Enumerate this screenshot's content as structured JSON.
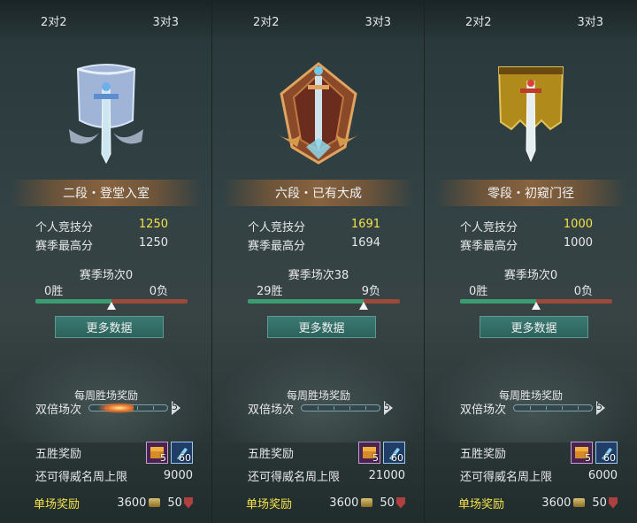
{
  "panels": [
    {
      "tabs": [
        "2对2",
        "3对3"
      ],
      "emblem": "blue-banner-sword-emblem",
      "rank_title": "二段・登堂入室",
      "personal_label": "个人竞技分",
      "personal_score": "1250",
      "season_best_label": "赛季最高分",
      "season_best": "1250",
      "season_matches": "赛季场次0",
      "wins": "0胜",
      "losses": "0负",
      "win_ratio": 0.5,
      "more_button": "更多数据",
      "weekly_title": "每周胜场奖励",
      "double_label": "双倍场次",
      "double_count": "5",
      "double_fire": true,
      "five_win_label": "五胜奖励",
      "five_win_items": [
        {
          "icon": "treasure-chest-icon",
          "count": "5"
        },
        {
          "icon": "blue-key-icon",
          "count": "60"
        }
      ],
      "renown_label": "还可得威名周上限",
      "renown_value": "9000",
      "single_label": "单场奖励",
      "single_coins": "3600",
      "single_honor": "50"
    },
    {
      "tabs": [
        "2对2",
        "3对3"
      ],
      "emblem": "bronze-crest-sword-emblem",
      "rank_title": "六段・已有大成",
      "personal_label": "个人竞技分",
      "personal_score": "1691",
      "season_best_label": "赛季最高分",
      "season_best": "1694",
      "season_matches": "赛季场次38",
      "wins": "29胜",
      "losses": "9负",
      "win_ratio": 0.763,
      "more_button": "更多数据",
      "weekly_title": "每周胜场奖励",
      "double_label": "双倍场次",
      "double_count": "5",
      "double_fire": false,
      "five_win_label": "五胜奖励",
      "five_win_items": [
        {
          "icon": "treasure-chest-icon",
          "count": "5"
        },
        {
          "icon": "blue-key-icon",
          "count": "60"
        }
      ],
      "renown_label": "还可得威名周上限",
      "renown_value": "21000",
      "single_label": "单场奖励",
      "single_coins": "3600",
      "single_honor": "50"
    },
    {
      "tabs": [
        "2对2",
        "3对3"
      ],
      "emblem": "gold-banner-sword-emblem",
      "rank_title": "零段・初窥门径",
      "personal_label": "个人竞技分",
      "personal_score": "1000",
      "season_best_label": "赛季最高分",
      "season_best": "1000",
      "season_matches": "赛季场次0",
      "wins": "0胜",
      "losses": "0负",
      "win_ratio": 0.5,
      "more_button": "更多数据",
      "weekly_title": "每周胜场奖励",
      "double_label": "双倍场次",
      "double_count": "5",
      "double_fire": false,
      "five_win_label": "五胜奖励",
      "five_win_items": [
        {
          "icon": "treasure-chest-icon",
          "count": "5"
        },
        {
          "icon": "blue-key-icon",
          "count": "60"
        }
      ],
      "renown_label": "还可得威名周上限",
      "renown_value": "6000",
      "single_label": "单场奖励",
      "single_coins": "3600",
      "single_honor": "50"
    }
  ],
  "colors": {
    "highlight": "#f4e24a",
    "win": "#3c9c70",
    "loss": "#9a4a3a",
    "button": "#2c625c"
  }
}
